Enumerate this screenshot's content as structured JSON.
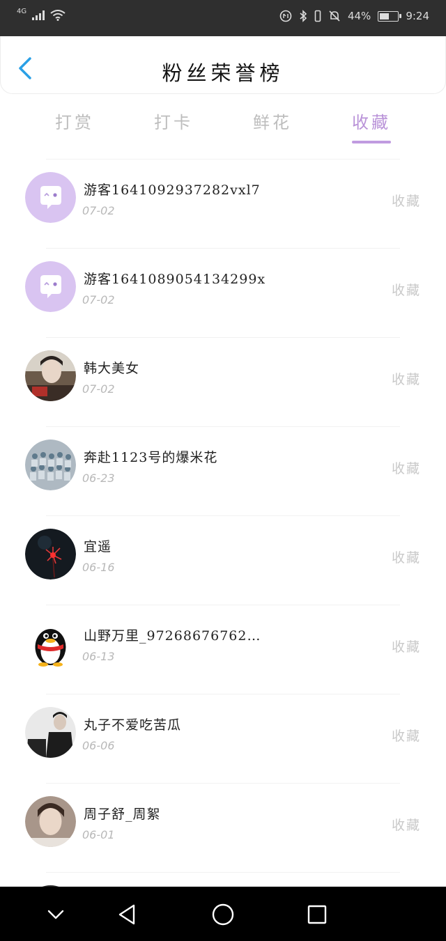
{
  "status_bar": {
    "network": "4G",
    "battery_percent": "44%",
    "time": "9:24",
    "icons": [
      "signal-icon",
      "wifi-icon",
      "data-saver-icon",
      "bluetooth-icon",
      "vibrate-icon",
      "mute-bell-icon",
      "battery-icon"
    ]
  },
  "header": {
    "title": "粉丝荣誉榜",
    "back_icon": "chevron-left-icon"
  },
  "tabs": [
    {
      "label": "打赏",
      "active": false
    },
    {
      "label": "打卡",
      "active": false
    },
    {
      "label": "鲜花",
      "active": false
    },
    {
      "label": "收藏",
      "active": true
    }
  ],
  "colors": {
    "accent": "#c09be0",
    "back_arrow": "#2aa0e6",
    "default_avatar_bg": "#d9c4f1"
  },
  "fans": [
    {
      "name": "游客1641092937282vxl7",
      "date": "07-02",
      "action": "收藏",
      "avatar": "default-chat-avatar"
    },
    {
      "name": "游客1641089054134299x",
      "date": "07-02",
      "action": "收藏",
      "avatar": "default-chat-avatar"
    },
    {
      "name": "韩大美女",
      "date": "07-02",
      "action": "收藏",
      "avatar": "user-photo-avatar"
    },
    {
      "name": "奔赴1123号的爆米花",
      "date": "06-23",
      "action": "收藏",
      "avatar": "group-photo-avatar"
    },
    {
      "name": "宜遥",
      "date": "06-16",
      "action": "收藏",
      "avatar": "red-flower-avatar"
    },
    {
      "name": "山野万里_97268676762…",
      "date": "06-13",
      "action": "收藏",
      "avatar": "penguin-avatar"
    },
    {
      "name": "丸子不爱吃苦瓜",
      "date": "06-06",
      "action": "收藏",
      "avatar": "user-photo-avatar"
    },
    {
      "name": "周子舒_周絮",
      "date": "06-01",
      "action": "收藏",
      "avatar": "user-photo-avatar"
    }
  ],
  "nav_bar": {
    "icons": [
      "collapse-down-icon",
      "back-triangle-icon",
      "home-circle-icon",
      "recents-square-icon"
    ]
  }
}
